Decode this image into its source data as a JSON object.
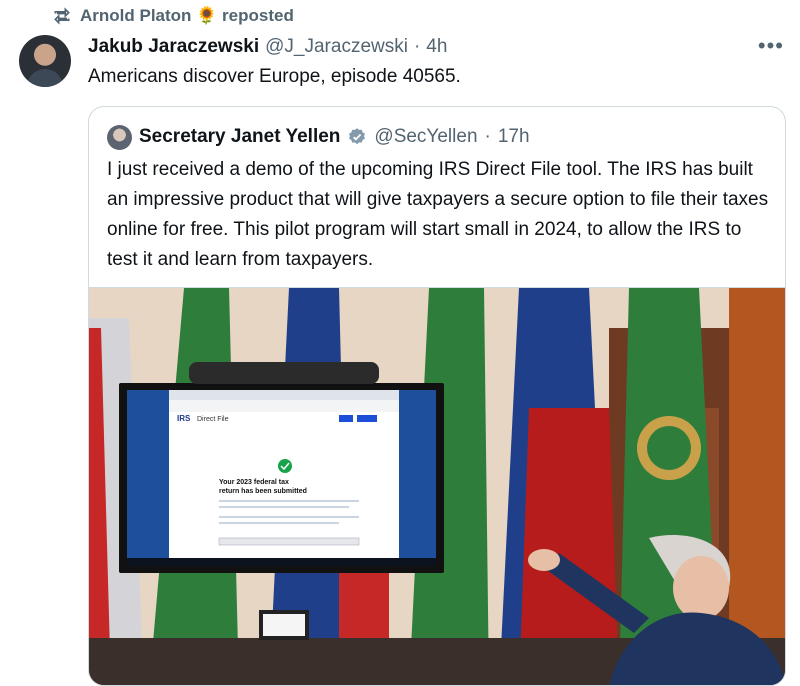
{
  "repost": {
    "text": "Arnold Platon 🌻 reposted"
  },
  "tweet": {
    "name": "Jakub Jaraczewski",
    "handle": "@J_Jaraczewski",
    "dot": "·",
    "time": "4h",
    "text": "Americans discover Europe, episode 40565.",
    "more": "•••"
  },
  "quote": {
    "name": "Secretary Janet Yellen",
    "handle": "@SecYellen",
    "dot": "·",
    "time": "17h",
    "text": "I just received a demo of the upcoming IRS Direct File tool. The IRS has built an impressive product that will give taxpayers a secure option to file their taxes online for free. This pilot program will start small in 2024, to allow the IRS to test it and learn from taxpayers."
  },
  "photo_screen": {
    "logo": "IRS",
    "product": "Direct File",
    "headline_line1": "Your 2023 federal tax",
    "headline_line2": "return has been submitted"
  },
  "colors": {
    "accent": "#1d9bf0",
    "muted": "#536471",
    "border": "#cfd9de",
    "flag_green": "#2e7d3a"
  }
}
